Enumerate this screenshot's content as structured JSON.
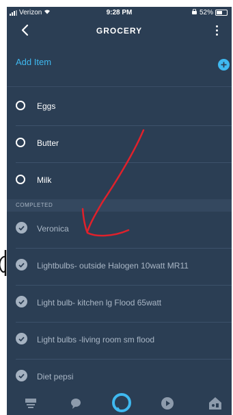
{
  "status_bar": {
    "carrier": "Verizon",
    "time": "9:28 PM",
    "battery": "52%"
  },
  "header": {
    "title": "GROCERY"
  },
  "add_item": {
    "label": "Add Item"
  },
  "active_items": [
    {
      "label": "Eggs"
    },
    {
      "label": "Butter"
    },
    {
      "label": "Milk"
    }
  ],
  "completed": {
    "header": "COMPLETED",
    "items": [
      {
        "label": "Veronica"
      },
      {
        "label": "Lightbulbs- outside Halogen 10watt MR11"
      },
      {
        "label": "Light bulb- kitchen  lg Flood 65watt"
      },
      {
        "label": "Light bulbs  -living room sm flood"
      },
      {
        "label": "Diet pepsi"
      }
    ]
  },
  "bottom_nav": [
    {
      "icon": "home-icon"
    },
    {
      "icon": "communicate-icon"
    },
    {
      "icon": "alexa-icon"
    },
    {
      "icon": "play-icon"
    },
    {
      "icon": "devices-icon"
    }
  ],
  "colors": {
    "background": "#2b3e54",
    "accent": "#3fb9f0",
    "completed_text": "#aab7c6",
    "annotation": "#e0212b"
  }
}
